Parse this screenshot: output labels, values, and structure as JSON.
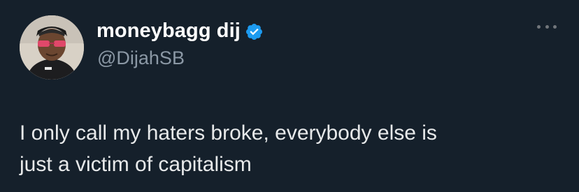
{
  "tweet": {
    "display_name": "moneybagg dij",
    "handle": "@DijahSB",
    "text": "I only call my haters broke, everybody else is\njust a victim of capitalism",
    "verified_icon": "verified-badge-icon",
    "more_icon": "more-options-icon"
  },
  "colors": {
    "background": "#15202b",
    "name": "#ffffff",
    "handle": "#8b98a5",
    "text": "#e7e9ea",
    "verified": "#1d9bf0"
  }
}
